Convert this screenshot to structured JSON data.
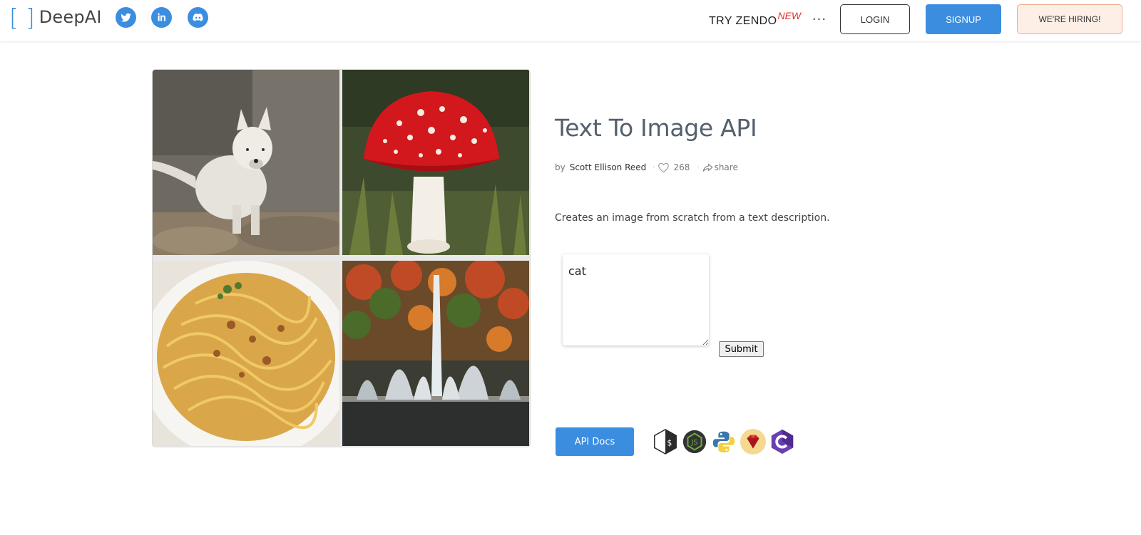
{
  "header": {
    "logo_left": "[",
    "logo_right": "]",
    "logo_word": "DeepAI",
    "social_icons": [
      "twitter-icon",
      "linkedin-icon",
      "discord-icon"
    ],
    "try_zendo": "TRY ZENDO",
    "new_badge": "NEW",
    "more_label": "···",
    "login": "LOGIN",
    "signup": "SIGNUP",
    "hiring": "WE'RE HIRING!",
    "accent_color": "#3b8de0"
  },
  "gallery": {
    "images": [
      "white wolf",
      "red fly agaric mushroom",
      "pasta dish",
      "fountain with autumn trees"
    ]
  },
  "main": {
    "title": "Text To Image API",
    "by": "by",
    "author": "Scott Ellison Reed",
    "likes": "268",
    "share": "share",
    "description": "Creates an image from scratch from a text description.",
    "input_value": "cat",
    "submit": "Submit",
    "api_docs": "API Docs",
    "languages": [
      "bash-icon",
      "nodejs-icon",
      "python-icon",
      "ruby-icon",
      "csharp-icon"
    ]
  }
}
